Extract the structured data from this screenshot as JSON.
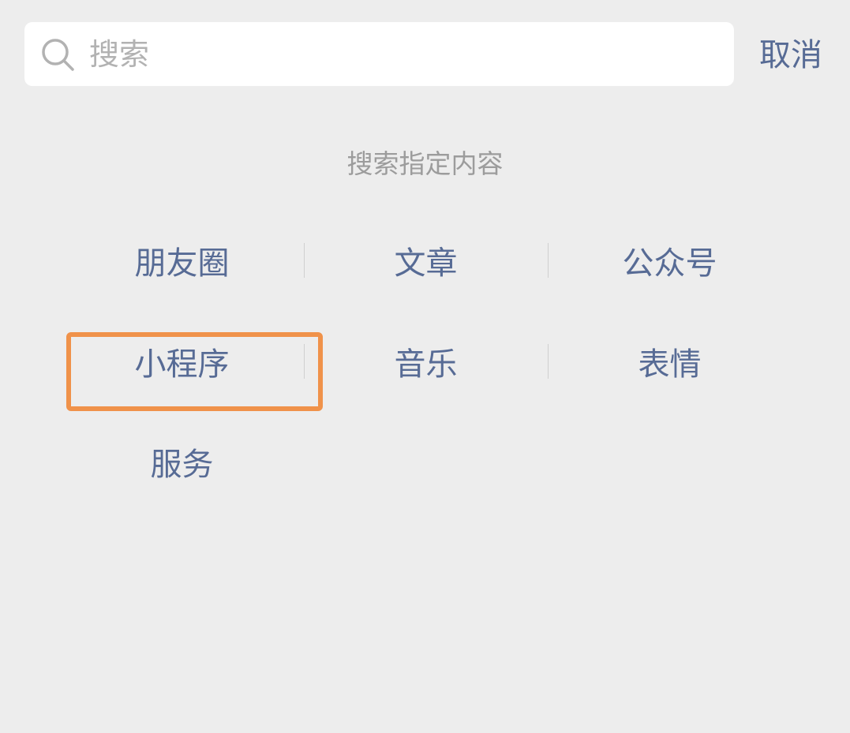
{
  "search": {
    "placeholder": "搜索",
    "icon": "search-icon",
    "cancel_label": "取消"
  },
  "section_title": "搜索指定内容",
  "categories": [
    {
      "label": "朋友圈"
    },
    {
      "label": "文章"
    },
    {
      "label": "公众号"
    },
    {
      "label": "小程序"
    },
    {
      "label": "音乐"
    },
    {
      "label": "表情"
    },
    {
      "label": "服务"
    }
  ],
  "highlight": {
    "target": "小程序",
    "color": "#f0924a"
  },
  "colors": {
    "background": "#ededed",
    "link": "#576b95",
    "muted": "#9c9c9c"
  }
}
